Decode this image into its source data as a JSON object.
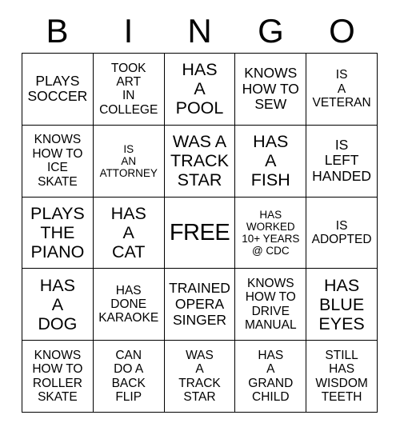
{
  "header": {
    "letters": [
      "B",
      "I",
      "N",
      "G",
      "O"
    ]
  },
  "grid": {
    "rows": 5,
    "columns": 5,
    "border_color": "#000000",
    "background_color": "#ffffff",
    "text_color": "#000000",
    "cells": [
      {
        "text": "PLAYS\nSOCCER",
        "size": "m",
        "free": false
      },
      {
        "text": "TOOK\nART\nIN\nCOLLEGE",
        "size": "s",
        "free": false
      },
      {
        "text": "HAS\nA\nPOOL",
        "size": "l",
        "free": false
      },
      {
        "text": "KNOWS\nHOW TO\nSEW",
        "size": "m",
        "free": false
      },
      {
        "text": "IS\nA\nVETERAN",
        "size": "s",
        "free": false
      },
      {
        "text": "KNOWS\nHOW TO\nICE\nSKATE",
        "size": "s",
        "free": false
      },
      {
        "text": "IS\nAN\nATTORNEY",
        "size": "xs",
        "free": false
      },
      {
        "text": "WAS A\nTRACK\nSTAR",
        "size": "l",
        "free": false
      },
      {
        "text": "HAS\nA\nFISH",
        "size": "l",
        "free": false
      },
      {
        "text": "IS\nLEFT\nHANDED",
        "size": "m",
        "free": false
      },
      {
        "text": "PLAYS\nTHE\nPIANO",
        "size": "l",
        "free": false
      },
      {
        "text": "HAS\nA\nCAT",
        "size": "l",
        "free": false
      },
      {
        "text": "FREE",
        "size": "xl",
        "free": true
      },
      {
        "text": "HAS\nWORKED\n10+ YEARS\n@ CDC",
        "size": "xs",
        "free": false
      },
      {
        "text": "IS\nADOPTED",
        "size": "s",
        "free": false
      },
      {
        "text": "HAS\nA\nDOG",
        "size": "l",
        "free": false
      },
      {
        "text": "HAS\nDONE\nKARAOKE",
        "size": "s",
        "free": false
      },
      {
        "text": "TRAINED\nOPERA\nSINGER",
        "size": "m",
        "free": false
      },
      {
        "text": "KNOWS\nHOW TO\nDRIVE\nMANUAL",
        "size": "s",
        "free": false
      },
      {
        "text": "HAS\nBLUE\nEYES",
        "size": "l",
        "free": false
      },
      {
        "text": "KNOWS\nHOW TO\nROLLER\nSKATE",
        "size": "s",
        "free": false
      },
      {
        "text": "CAN\nDO A\nBACK\nFLIP",
        "size": "s",
        "free": false
      },
      {
        "text": "WAS\nA\nTRACK\nSTAR",
        "size": "s",
        "free": false
      },
      {
        "text": "HAS\nA\nGRAND\nCHILD",
        "size": "s",
        "free": false
      },
      {
        "text": "STILL\nHAS\nWISDOM\nTEETH",
        "size": "s",
        "free": false
      }
    ]
  }
}
